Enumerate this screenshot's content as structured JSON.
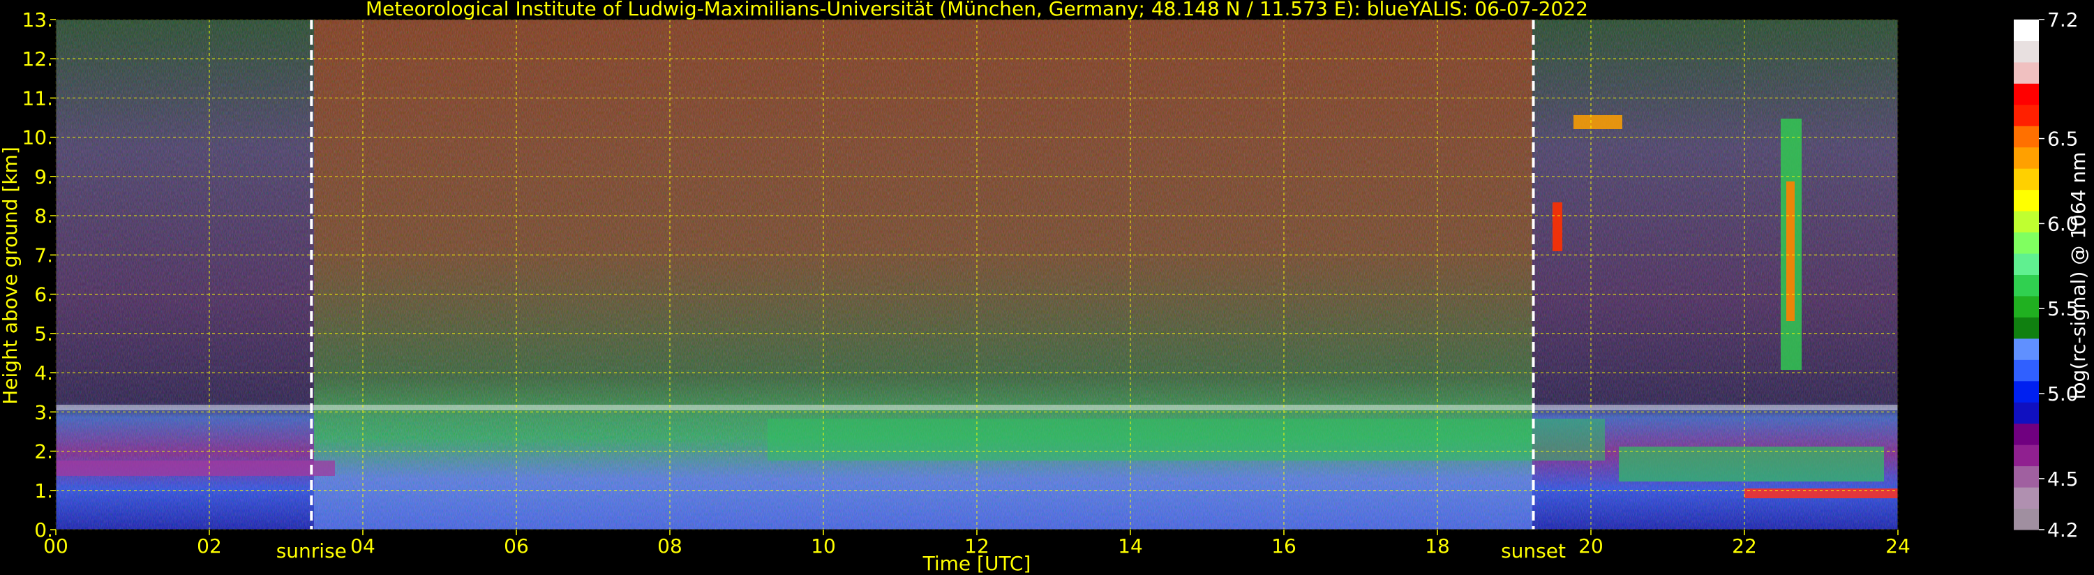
{
  "chart_data": {
    "type": "heatmap",
    "title": "Meteorological Institute of Ludwig-Maximilians-Universität (München, Germany; 48.148 N / 11.573 E):     blueYALIS: 06-07-2022",
    "xlabel": "Time [UTC]",
    "ylabel": "Height above ground [km]",
    "xlim": [
      0,
      24
    ],
    "ylim": [
      0,
      13
    ],
    "x_ticks": [
      "00",
      "02",
      "04",
      "06",
      "08",
      "10",
      "12",
      "14",
      "16",
      "18",
      "20",
      "22",
      "24"
    ],
    "y_ticks": [
      "0.",
      "1.",
      "2.",
      "3.",
      "4.",
      "5.",
      "6.",
      "7.",
      "8.",
      "9.",
      "10.",
      "11.",
      "12.",
      "13."
    ],
    "grid": true,
    "colorbar": {
      "label": "log(rc-signal) @ 1064 nm",
      "range": [
        4.2,
        7.2
      ],
      "ticks": [
        "4.2",
        "4.5",
        "5.0",
        "5.5",
        "6.0",
        "6.5",
        "7.2"
      ],
      "colors": [
        "#a08fa0",
        "#b090b0",
        "#a060a0",
        "#902090",
        "#700080",
        "#1010c0",
        "#0020f0",
        "#3060ff",
        "#6090ff",
        "#108010",
        "#20b020",
        "#30d050",
        "#60f090",
        "#80ff60",
        "#c0ff30",
        "#ffff00",
        "#ffd000",
        "#ffa000",
        "#ff7000",
        "#ff2000",
        "#ff0000",
        "#f0c0c0",
        "#e8e0e0",
        "#ffffff"
      ]
    },
    "annotations": [
      {
        "label": "sunrise",
        "x": 3.33
      },
      {
        "label": "sunset",
        "x": 19.25
      }
    ]
  }
}
